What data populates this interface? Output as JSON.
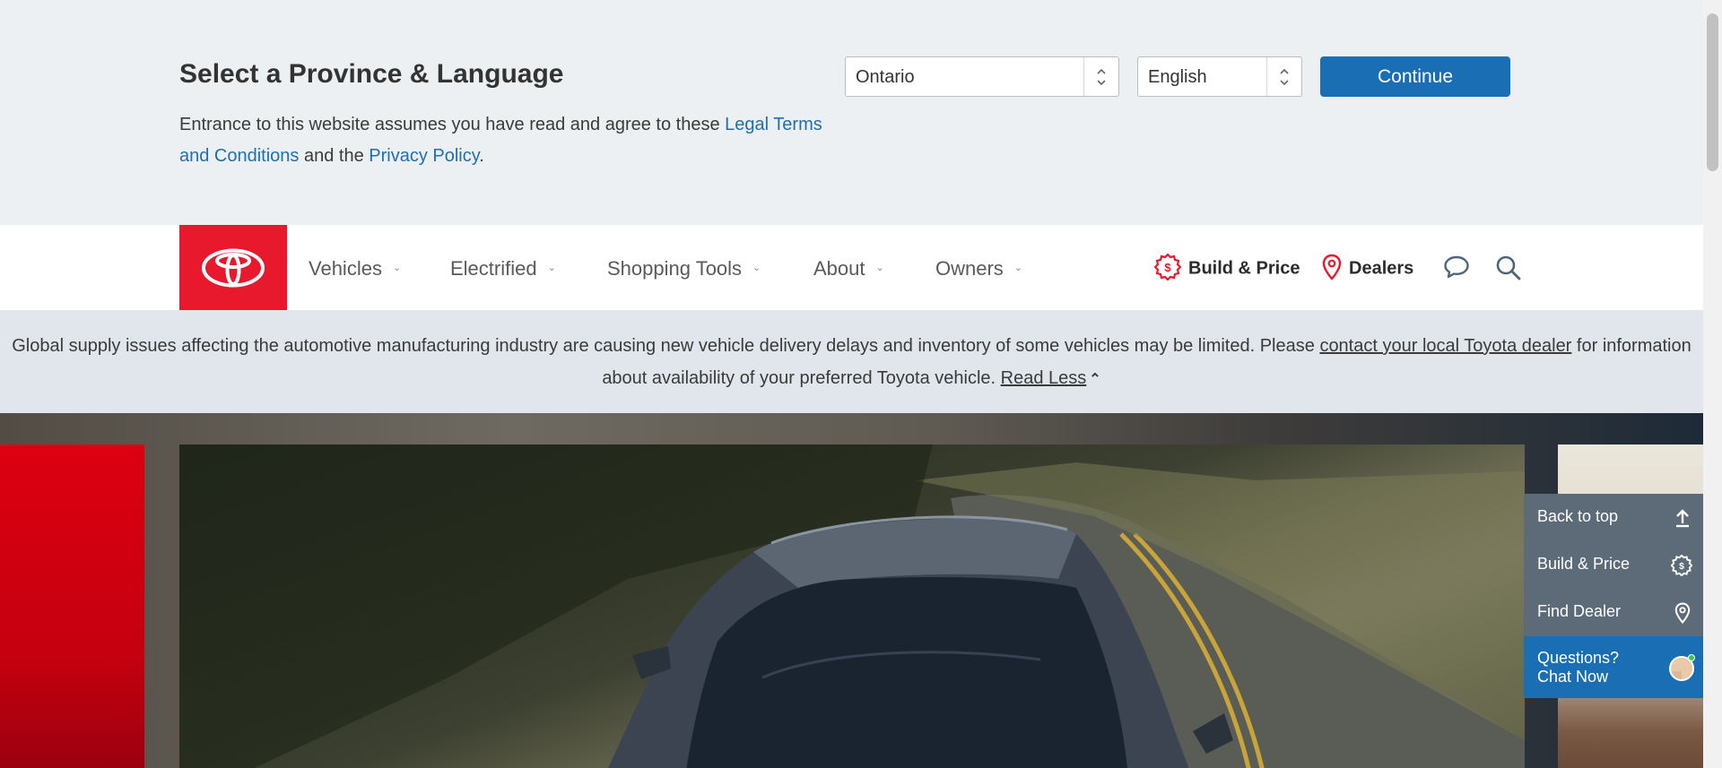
{
  "province_bar": {
    "title": "Select a Province & Language",
    "text_before": "Entrance to this website assumes you have read and agree to these ",
    "legal_link": "Legal Terms and Conditions",
    "text_middle": " and the ",
    "privacy_link": "Privacy Policy",
    "text_end": ".",
    "province_value": "Ontario",
    "language_value": "English",
    "continue_label": "Continue"
  },
  "nav": {
    "items": [
      {
        "label": "Vehicles"
      },
      {
        "label": "Electrified"
      },
      {
        "label": "Shopping Tools"
      },
      {
        "label": "About"
      },
      {
        "label": "Owners"
      }
    ],
    "build_price": "Build & Price",
    "dealers": "Dealers"
  },
  "notice": {
    "text_before": "Global supply issues affecting the automotive manufacturing industry are causing new vehicle delivery delays and inventory of some vehicles may be limited. Please ",
    "dealer_link": "contact your local Toyota dealer",
    "text_after": " for information about availability of your preferred Toyota vehicle. ",
    "read_less": "Read Less"
  },
  "quick_links": {
    "back_to_top": "Back to top",
    "build_price": "Build & Price",
    "find_dealer": "Find Dealer",
    "chat_line1": "Questions?",
    "chat_line2": "Chat Now"
  },
  "colors": {
    "brand_red": "#e8192c",
    "link_blue": "#1f6fad",
    "button_blue": "#1a6fb4",
    "quick_link_gray": "#5d6a78"
  },
  "icons": [
    "toyota-logo",
    "build-price-icon",
    "location-pin-icon",
    "chat-bubble-icon",
    "search-icon",
    "arrow-up-icon",
    "chevron-down-icon"
  ]
}
